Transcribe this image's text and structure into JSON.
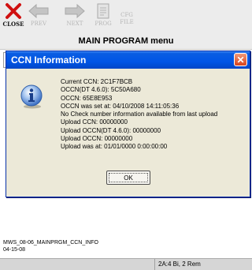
{
  "toolbar": {
    "close_label": "CLOSE",
    "prev_label": "PREV",
    "next_label": "NEXT",
    "prog_label": "PROG",
    "cfg_file_line1": "CFG",
    "cfg_file_line2": "FILE"
  },
  "window": {
    "title": "MAIN PROGRAM menu"
  },
  "dialog": {
    "title": "CCN Information",
    "lines": [
      "Current CCN: 2C1F7BCB",
      "OCCN(DT 4.6.0): 5C50A680",
      "OCCN: 65E8E953",
      "OCCN was set at: 04/10/2008 14:11:05:36",
      "No Check number information available from last upload",
      "Upload CCN: 00000000",
      "Upload OCCN(DT 4.6.0): 00000000",
      "Upload OCCN: 00000000",
      "Upload was at: 01/01/0000 0:00:00:00"
    ],
    "ok_label": "OK"
  },
  "footer": {
    "screen_id": "MWS_08-06_MAINPRGM_CCN_INFO",
    "date": "04-15-08"
  },
  "status": {
    "text": "2A:4 Bi, 2 Rem"
  }
}
